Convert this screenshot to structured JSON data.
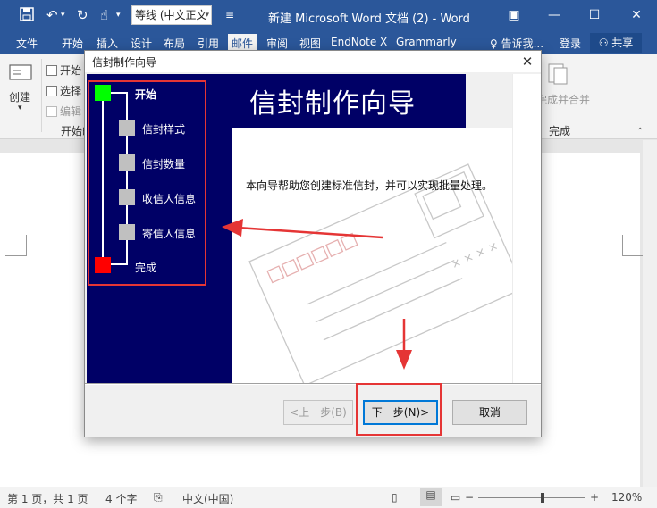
{
  "word": {
    "title": "新建 Microsoft Word 文档 (2) - Word",
    "font_name": "等线 (中文正文",
    "tabs": [
      "文件",
      "开始",
      "插入",
      "设计",
      "布局",
      "引用",
      "邮件",
      "审阅",
      "视图",
      "EndNote X",
      "Grammarly"
    ],
    "active_tab": "邮件",
    "tell_me": "♀ 告诉我...",
    "login": "登录",
    "share": "共享"
  },
  "ribbon": {
    "create_label": "创建",
    "start_label": "开始",
    "select_label": "选择",
    "edit_label": "编辑",
    "group_start": "开始邮",
    "finish_merge": "完成并合并",
    "group_finish": "完成"
  },
  "dialog": {
    "title": "信封制作向导",
    "banner": "信封制作向导",
    "intro": "本向导帮助您创建标准信封，并可以实现批量处理。",
    "steps": {
      "start": "开始",
      "style": "信封样式",
      "count": "信封数量",
      "recipient": "收信人信息",
      "sender": "寄信人信息",
      "finish": "完成"
    },
    "envelope_stamp": "× × × ×",
    "buttons": {
      "prev": "<上一步(B)",
      "next": "下一步(N)>",
      "cancel": "取消"
    }
  },
  "status": {
    "page": "第 1 页，共 1 页",
    "words": "4 个字",
    "language": "中文(中国)",
    "zoom": "120%",
    "minus": "−",
    "plus": "+"
  },
  "colors": {
    "word_blue": "#2b579a",
    "wizard_navy": "#000066",
    "step_start": "#00ff00",
    "step_finish": "#ff0000",
    "annotation_red": "#e53535"
  }
}
